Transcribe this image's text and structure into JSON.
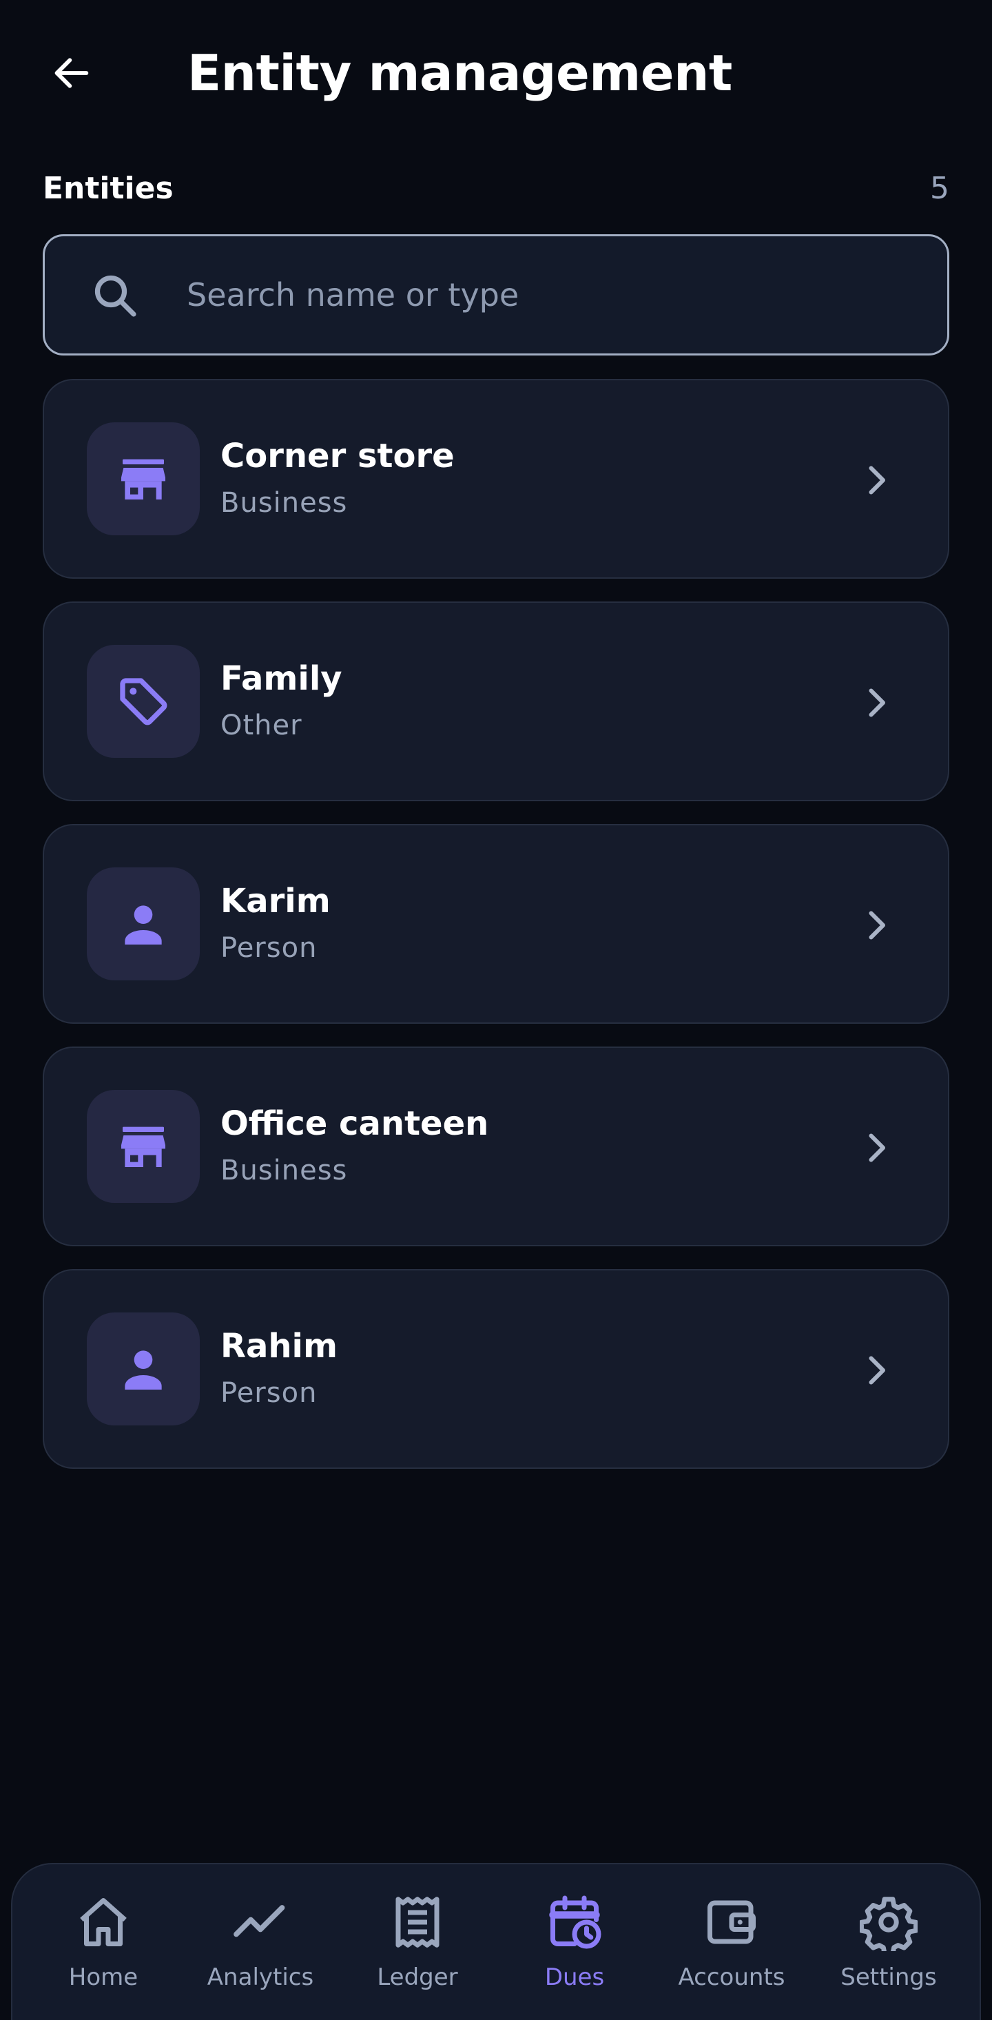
{
  "header": {
    "title": "Entity management",
    "back_icon": "arrow-left-icon"
  },
  "section": {
    "label": "Entities",
    "count": "5"
  },
  "search": {
    "placeholder": "Search name or type",
    "value": "",
    "icon": "search-icon"
  },
  "entities": [
    {
      "name": "Corner store",
      "type": "Business",
      "icon": "store-icon"
    },
    {
      "name": "Family",
      "type": "Other",
      "icon": "tag-icon"
    },
    {
      "name": "Karim",
      "type": "Person",
      "icon": "person-icon"
    },
    {
      "name": "Office canteen",
      "type": "Business",
      "icon": "store-icon"
    },
    {
      "name": "Rahim",
      "type": "Person",
      "icon": "person-icon"
    }
  ],
  "nav": {
    "active": "Dues",
    "items": [
      {
        "label": "Home",
        "icon": "home-icon"
      },
      {
        "label": "Analytics",
        "icon": "trend-line-icon"
      },
      {
        "label": "Ledger",
        "icon": "receipt-icon"
      },
      {
        "label": "Dues",
        "icon": "calendar-clock-icon"
      },
      {
        "label": "Accounts",
        "icon": "wallet-icon"
      },
      {
        "label": "Settings",
        "icon": "gear-icon"
      }
    ]
  },
  "colors": {
    "background": "#080b13",
    "card": "#151b2b",
    "accent": "#8b7cf6",
    "muted_text": "#98a3b8",
    "icon_tile": "#252843"
  }
}
